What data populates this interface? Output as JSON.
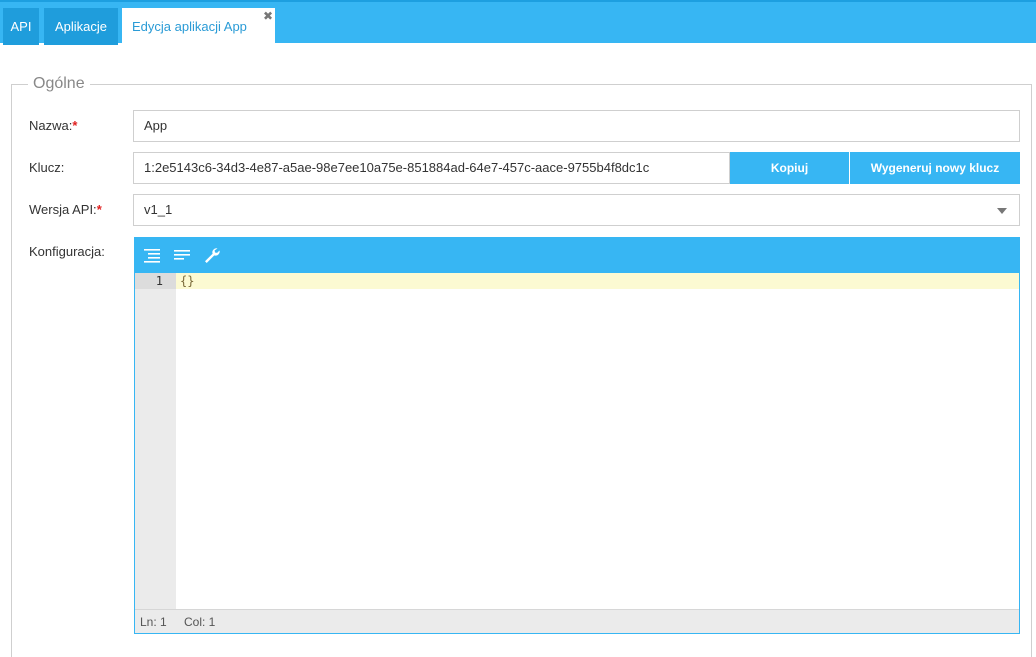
{
  "tabs": [
    {
      "label": "API"
    },
    {
      "label": "Aplikacje"
    },
    {
      "label": "Edycja aplikacji App",
      "close": "✖"
    }
  ],
  "section": {
    "legend": "Ogólne"
  },
  "form": {
    "name": {
      "label": "Nazwa:",
      "required": "*",
      "value": "App"
    },
    "key": {
      "label": "Klucz:",
      "value": "1:2e5143c6-34d3-4e87-a5ae-98e7ee10a75e-851884ad-64e7-457c-aace-9755b4f8dc1c",
      "copy_label": "Kopiuj",
      "regenerate_label": "Wygeneruj nowy klucz"
    },
    "api_version": {
      "label": "Wersja API:",
      "required": "*",
      "value": "v1_1"
    },
    "config": {
      "label": "Konfiguracja:"
    }
  },
  "editor": {
    "toolbar_icons": [
      "format-indent-icon",
      "align-left-icon",
      "wrench-icon"
    ],
    "line_number": "1",
    "code": "{}",
    "status_ln": "Ln: 1",
    "status_col": "Col: 1"
  },
  "colors": {
    "accent": "#37b6f3",
    "tab_dark": "#1f9ddc",
    "required": "#e02020",
    "active_line": "#fcfad2"
  }
}
